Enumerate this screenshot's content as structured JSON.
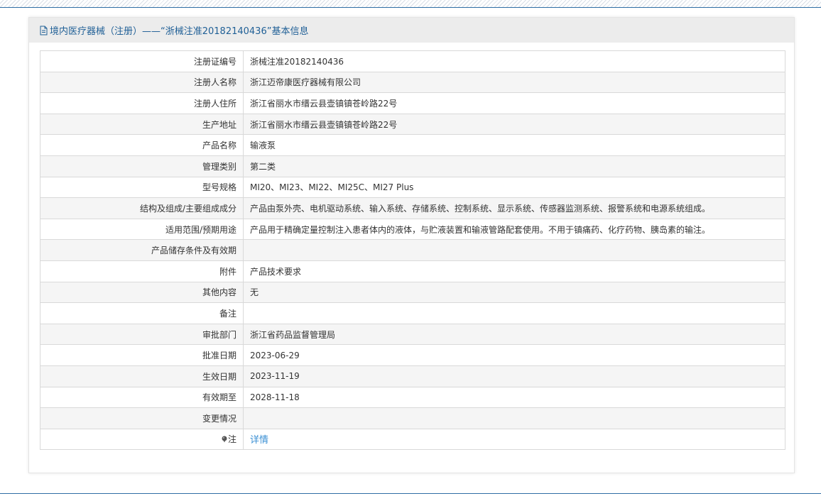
{
  "header": {
    "title": "境内医疗器械（注册）——“浙械注准20182140436”基本信息",
    "icon": "document-icon"
  },
  "rows": [
    {
      "label": "注册证编号",
      "value": "浙械注准20182140436"
    },
    {
      "label": "注册人名称",
      "value": "浙江迈帝康医疗器械有限公司"
    },
    {
      "label": "注册人住所",
      "value": "浙江省丽水市缙云县壶镇镇苍岭路22号"
    },
    {
      "label": "生产地址",
      "value": "浙江省丽水市缙云县壶镇镇苍岭路22号"
    },
    {
      "label": "产品名称",
      "value": "输液泵"
    },
    {
      "label": "管理类别",
      "value": "第二类"
    },
    {
      "label": "型号规格",
      "value": "MI20、MI23、MI22、MI25C、MI27 Plus"
    },
    {
      "label": "结构及组成/主要组成成分",
      "value": "产品由泵外壳、电机驱动系统、输入系统、存储系统、控制系统、显示系统、传感器监测系统、报警系统和电源系统组成。"
    },
    {
      "label": "适用范围/预期用途",
      "value": "产品用于精确定量控制注入患者体内的液体，与贮液装置和输液管路配套使用。不用于镇痛药、化疗药物、胰岛素的输注。"
    },
    {
      "label": "产品储存条件及有效期",
      "value": ""
    },
    {
      "label": "附件",
      "value": "产品技术要求"
    },
    {
      "label": "其他内容",
      "value": "无"
    },
    {
      "label": "备注",
      "value": ""
    },
    {
      "label": "审批部门",
      "value": "浙江省药品监督管理局"
    },
    {
      "label": "批准日期",
      "value": "2023-06-29"
    },
    {
      "label": "生效日期",
      "value": "2023-11-19"
    },
    {
      "label": "有效期至",
      "value": "2028-11-18"
    },
    {
      "label": "变更情况",
      "value": ""
    }
  ],
  "note_row": {
    "label": "注",
    "icon": "note-pin-icon",
    "link_text": "详情"
  },
  "colors": {
    "header_text": "#1f5f96",
    "link": "#3a8fd3",
    "stripe_row": "#f5f5f5",
    "border": "#d9d9d9"
  }
}
